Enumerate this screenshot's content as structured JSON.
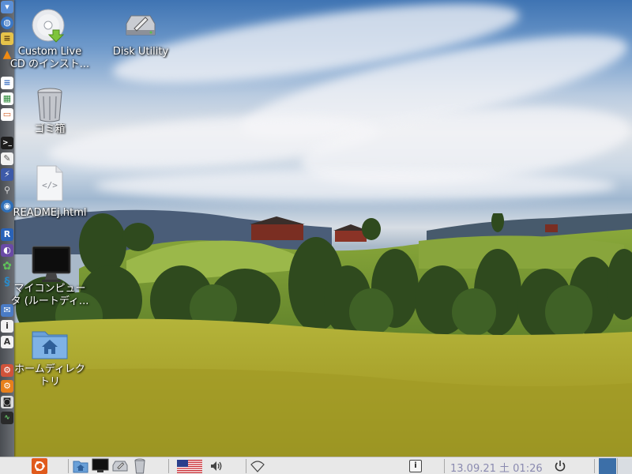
{
  "desktop_icons": [
    {
      "label_line1": "Custom Live",
      "label_line2": "CD のインスト..."
    },
    {
      "label_line1": "Disk Utility",
      "label_line2": ""
    },
    {
      "label_line1": "ゴミ箱",
      "label_line2": ""
    },
    {
      "label_line1": "READMEj.html",
      "label_line2": ""
    },
    {
      "label_line1": "マイコンピュー",
      "label_line2": "タ (ルートディ..."
    },
    {
      "label_line1": "ホームディレク",
      "label_line2": "トリ"
    }
  ],
  "file_icon_text": "</>",
  "dock_icons": [
    "finder-icon",
    "globe-icon",
    "notes-icon",
    "vlc-icon",
    "document-icon",
    "spreadsheet-icon",
    "presentation-icon",
    "terminal-icon",
    "text-editor-icon",
    "package-icon",
    "magnifier-icon",
    "browser-icon",
    "r-icon",
    "app-icon",
    "network-icon",
    "swirl-icon",
    "settings-icon",
    "info-icon",
    "font-icon",
    "tools-icon",
    "gear-icon",
    "camera-icon",
    "monitor-icon"
  ],
  "panel": {
    "info_label": "i",
    "clock": "13.09.21 土 01:26"
  },
  "colors": {
    "panel_bg": "#e8e8e8",
    "clock_text": "#8a8ab0",
    "menu_orange": "#e05a1c",
    "workspace_active": "#3c6fa8"
  }
}
